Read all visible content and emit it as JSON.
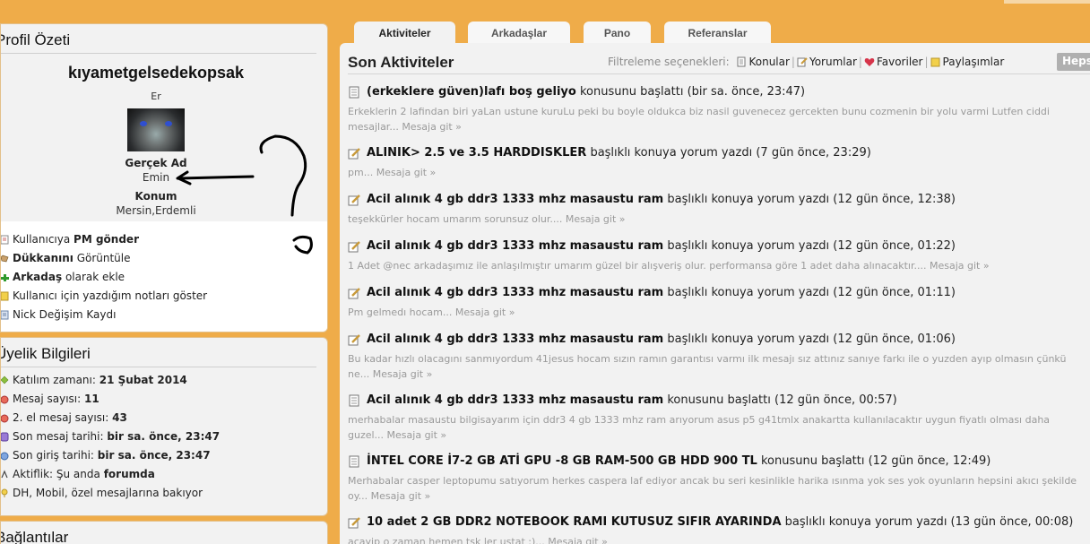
{
  "colors": {
    "page_bg": "#efac49",
    "panel_bg": "#f2f2f2",
    "excerpt": "#9a9a9a",
    "hepsi_bg": "#b0b0b0"
  },
  "profile": {
    "title": "Profil Özeti",
    "username": "kıyametgelsedekopsak",
    "gender": "Er",
    "real_name_label": "Gerçek Ad",
    "real_name": "Emin",
    "location_label": "Konum",
    "location": "Mersin,Erdemli",
    "actions": [
      {
        "pre": "Kullanıcıya ",
        "bold": "PM gönder",
        "post": "",
        "icon": "pm-icon"
      },
      {
        "pre": "",
        "bold": "Dükkanını",
        "post": " Görüntüle",
        "icon": "shop-icon"
      },
      {
        "pre": "",
        "bold": "Arkadaş",
        "post": " olarak ekle",
        "icon": "add-friend-icon"
      },
      {
        "pre": "Kullanıcı için yazdığım notları göster",
        "bold": "",
        "post": "",
        "icon": "notes-icon"
      },
      {
        "pre": "Nick Değişim Kaydı",
        "bold": "",
        "post": "",
        "icon": "history-icon"
      }
    ]
  },
  "membership": {
    "title": "Üyelik Bilgileri",
    "items": [
      {
        "label": "Katılım zamanı: ",
        "value": "21 Şubat 2014",
        "icon": "join-date-icon"
      },
      {
        "label": "Mesaj sayısı: ",
        "value": "11",
        "icon": "message-count-icon"
      },
      {
        "label": "2. el mesaj sayısı: ",
        "value": "43",
        "icon": "secondhand-count-icon"
      },
      {
        "label": "Son mesaj tarihi: ",
        "value": "bir sa. önce, 23:47",
        "icon": "last-message-icon"
      },
      {
        "label": "Son giriş tarihi: ",
        "value": "bir sa. önce, 23:47",
        "icon": "last-login-icon"
      },
      {
        "label": "Aktiflik: Şu anda ",
        "value": "forumda",
        "icon": "activity-icon"
      },
      {
        "label": "DH, Mobil, özel mesajlarına bakıyor",
        "value": "",
        "icon": "location-icon"
      }
    ]
  },
  "connections": {
    "title": "Bağlantılar"
  },
  "tabs": [
    "Aktiviteler",
    "Arkadaşlar",
    "Pano",
    "Referanslar"
  ],
  "activities": {
    "title": "Son Aktiviteler",
    "filter_label": "Filtreleme seçenekleri:",
    "filters": [
      "Konular",
      "Yorumlar",
      "Favoriler",
      "Paylaşımlar"
    ],
    "all_label": "Hepsi",
    "items": [
      {
        "type": "thread",
        "title": "(erkeklere güven)lafı boş geliyo",
        "action": " konusunu başlattı (bir sa. önce, 23:47)",
        "excerpt": "Erkeklerin 2 lafindan biri yaLan ustune kuruLu peki bu boyle oldukca biz nasil guvenecez gercekten bunu cozmenin bir yolu varmi Lutfen ciddi mesajlar...",
        "go": "Mesaja git »"
      },
      {
        "type": "comment",
        "title": "ALINIK> 2.5 ve 3.5 HARDDISKLER",
        "action": " başlıklı konuya yorum yazdı (7 gün önce, 23:29)",
        "excerpt": "pm...",
        "go": "Mesaja git »"
      },
      {
        "type": "comment",
        "title": "Acil alınık 4 gb ddr3 1333 mhz masaustu ram",
        "action": " başlıklı konuya yorum yazdı (12 gün önce, 12:38)",
        "excerpt": "teşekkürler hocam umarım sorunsuz olur....",
        "go": "Mesaja git »"
      },
      {
        "type": "comment",
        "title": "Acil alınık 4 gb ddr3 1333 mhz masaustu ram",
        "action": " başlıklı konuya yorum yazdı (12 gün önce, 01:22)",
        "excerpt": "1 Adet @nec arkadaşımız ile anlaşılmıştır umarım güzel bir alışveriş olur. performansa göre 1 adet daha alınacaktır....",
        "go": "Mesaja git »"
      },
      {
        "type": "comment",
        "title": "Acil alınık 4 gb ddr3 1333 mhz masaustu ram",
        "action": " başlıklı konuya yorum yazdı (12 gün önce, 01:11)",
        "excerpt": "Pm gelmedı hocam...",
        "go": "Mesaja git »"
      },
      {
        "type": "comment",
        "title": "Acil alınık 4 gb ddr3 1333 mhz masaustu ram",
        "action": " başlıklı konuya yorum yazdı (12 gün önce, 01:06)",
        "excerpt": "Bu kadar hızlı olacagını sanmıyordum 41jesus hocam sızın ramın garantısı varmı ilk mesajı sız attınız sanıye farkı ile o yuzden ayıp olmasın çünkü ne...",
        "go": "Mesaja git »"
      },
      {
        "type": "thread",
        "title": "Acil alınık 4 gb ddr3 1333 mhz masaustu ram",
        "action": " konusunu başlattı (12 gün önce, 00:57)",
        "excerpt": "merhabalar masaustu bilgisayarım için ddr3 4 gb 1333 mhz ram arıyorum asus p5 g41tmlx anakartta kullanılacaktır uygun fiyatlı olması daha guzel...",
        "go": "Mesaja git »"
      },
      {
        "type": "thread",
        "title": "İNTEL CORE İ7-2 GB ATİ GPU -8 GB RAM-500 GB HDD 900 TL",
        "action": " konusunu başlattı (12 gün önce, 12:49)",
        "excerpt": "Merhabalar casper leptopumu satıyorum herkes caspera laf ediyor ancak bu seri kesinlikle harika ısınma yok ses yok oyunların hepsini akıcı şekilde oy...",
        "go": "Mesaja git »"
      },
      {
        "type": "comment",
        "title": "10 adet 2 GB DDR2 NOTEBOOK RAMI KUTUSUZ SIFIR AYARINDA",
        "action": " başlıklı konuya yorum yazdı (13 gün önce, 00:08)",
        "excerpt": "acayip o zaman hemen tsk ler ustat :)...",
        "go": "Mesaja git »"
      }
    ]
  }
}
